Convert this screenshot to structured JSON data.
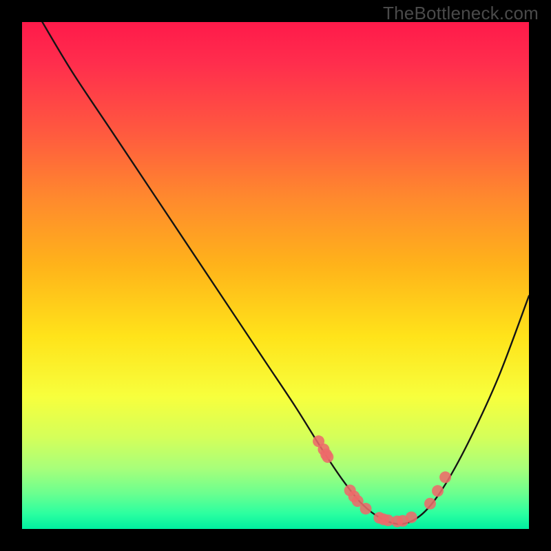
{
  "watermark": "TheBottleneck.com",
  "chart_data": {
    "type": "line",
    "title": "",
    "xlabel": "",
    "ylabel": "",
    "xlim": [
      0,
      100
    ],
    "ylim": [
      0,
      100
    ],
    "series": [
      {
        "name": "bottleneck-curve",
        "x": [
          4,
          10,
          18,
          26,
          34,
          42,
          48,
          54,
          59,
          63,
          67,
          71,
          75,
          79,
          83,
          88,
          94,
          100
        ],
        "y": [
          100,
          90,
          78,
          66,
          54,
          42,
          33,
          24,
          16,
          10,
          5,
          2,
          1,
          3,
          8,
          17,
          30,
          46
        ]
      }
    ],
    "markers": {
      "name": "highlight-points",
      "x": [
        58.5,
        59.5,
        60,
        60.3,
        64.7,
        65.5,
        66.2,
        67.8,
        70.5,
        71.3,
        72.2,
        74.0,
        75.1,
        76.8,
        80.5,
        82.0,
        83.5
      ],
      "y": [
        17.3,
        15.7,
        14.7,
        14.2,
        7.6,
        6.4,
        5.5,
        4.0,
        2.2,
        1.9,
        1.7,
        1.5,
        1.6,
        2.3,
        5.0,
        7.5,
        10.2
      ]
    },
    "colors": {
      "curve": "#141414",
      "marker": "#ed6a6a",
      "background_top": "#ff1a4a",
      "background_bottom": "#00efa0"
    }
  }
}
